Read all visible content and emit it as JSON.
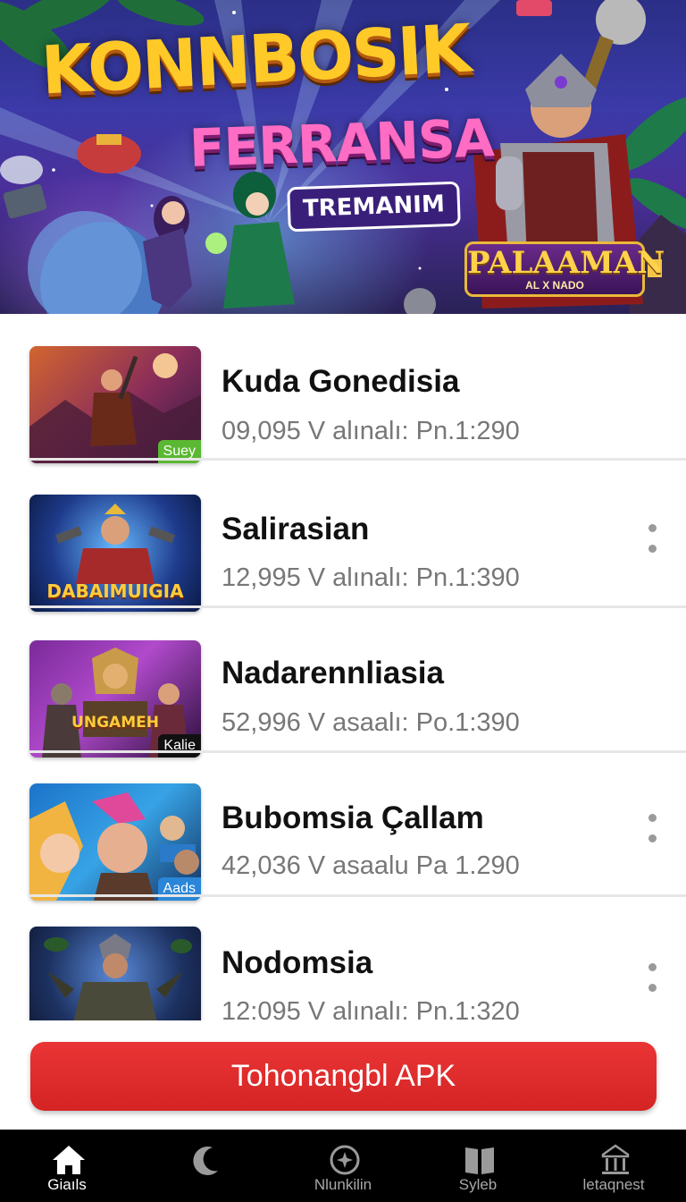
{
  "banner": {
    "title_line1": "KONNBOSIK",
    "title_line2": "FERRANSA",
    "pill_text": "TREMANIM",
    "badge_title": "PALAAMAN",
    "badge_sub": "AL X NADO"
  },
  "items": [
    {
      "title": "Kuda Gonedisia",
      "meta": "09,095 V alınalı: Pn.1:290",
      "thumb_tag": "Suey",
      "thumb_tag_color": "#5ab832",
      "thumb_caption": "",
      "has_menu": false
    },
    {
      "title": "Salirasian",
      "meta": "12,995 V alınalı: Pn.1:390",
      "thumb_tag": "",
      "thumb_tag_color": "",
      "thumb_caption": "DABAIMUIGIA",
      "has_menu": true
    },
    {
      "title": "Nadarennliasia",
      "meta": "52,996 V asaalı: Po.1:390",
      "thumb_tag": "Kalie",
      "thumb_tag_color": "#111111",
      "thumb_caption": "UNGAMEH",
      "has_menu": false
    },
    {
      "title": "Bubomsia Çallam",
      "meta": "42,036 V asaalu Pa 1.290",
      "thumb_tag": "Aads",
      "thumb_tag_color": "#2a86d8",
      "thumb_caption": "",
      "has_menu": true
    },
    {
      "title": "Nodomsia",
      "meta": "12:095 V alınalı: Pn.1:320",
      "thumb_tag": "",
      "thumb_tag_color": "",
      "thumb_caption": "",
      "has_menu": true
    }
  ],
  "cta": {
    "label": "Tohonangbl APK"
  },
  "nav": [
    {
      "label": "Giaıls",
      "icon": "home-icon",
      "active": true
    },
    {
      "label": "",
      "icon": "moon-icon",
      "active": false
    },
    {
      "label": "Nlunkilin",
      "icon": "compass-icon",
      "active": false
    },
    {
      "label": "Syleb",
      "icon": "book-icon",
      "active": false
    },
    {
      "label": "letaqnest",
      "icon": "bank-icon",
      "active": false
    }
  ]
}
